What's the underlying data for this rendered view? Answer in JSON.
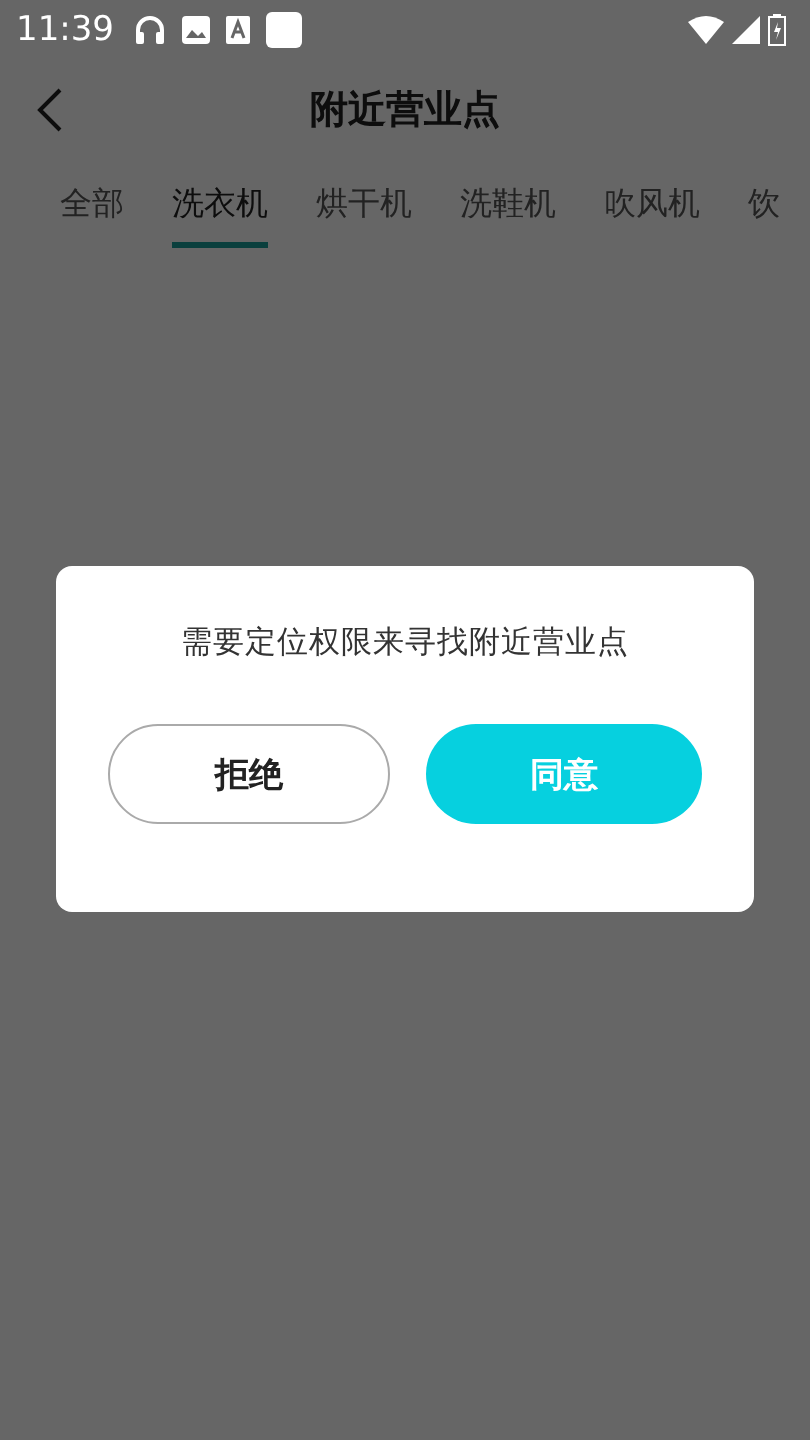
{
  "status_bar": {
    "time": "11:39"
  },
  "header": {
    "title": "附近营业点"
  },
  "tabs": [
    {
      "label": "全部",
      "selected": false
    },
    {
      "label": "洗衣机",
      "selected": true
    },
    {
      "label": "烘干机",
      "selected": false
    },
    {
      "label": "洗鞋机",
      "selected": false
    },
    {
      "label": "吹风机",
      "selected": false
    },
    {
      "label": "饮",
      "selected": false
    }
  ],
  "dialog": {
    "message": "需要定位权限来寻找附近营业点",
    "buttons": [
      {
        "label": "拒绝",
        "kind": "secondary"
      },
      {
        "label": "同意",
        "kind": "primary"
      }
    ]
  }
}
